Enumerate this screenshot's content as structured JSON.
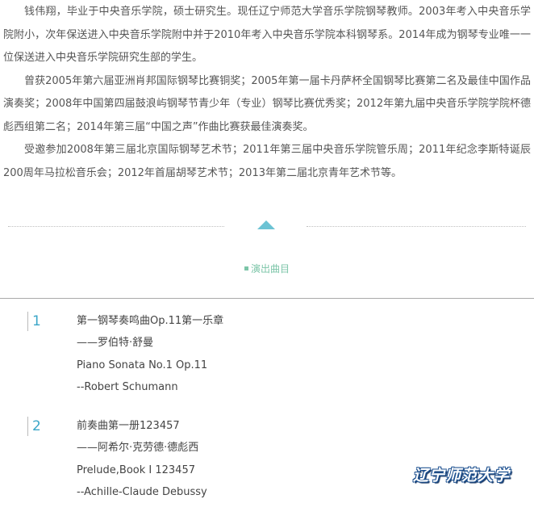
{
  "bio": {
    "paragraphs": [
      "钱伟翔，毕业于中央音乐学院，硕士研究生。现任辽宁师范大学音乐学院钢琴教师。2003年考入中央音乐学院附小，次年保送进入中央音乐学院附中并于2010年考入中央音乐学院本科钢琴系。2014年成为钢琴专业唯一一位保送进入中央音乐学院研究生部的学生。",
      "曾获2005年第六届亚洲肖邦国际钢琴比赛铜奖；2005年第一届卡丹萨杯全国钢琴比赛第二名及最佳中国作品演奏奖；2008年中国第四届鼓浪屿钢琴节青少年（专业）钢琴比赛优秀奖；2012年第九届中央音乐学院学院杯德彪西组第二名；2014年第三届“中国之声”作曲比赛获最佳演奏奖。",
      "受邀参加2008年第三届北京国际钢琴艺术节；2011年第三届中央音乐学院管乐周；2011年纪念李斯特诞辰200周年马拉松音乐会；2012年首届胡琴艺术节；2013年第二届北京青年艺术节等。"
    ]
  },
  "section": {
    "label": "演出曲目"
  },
  "program": [
    {
      "number": "1",
      "title_cn": "第一钢琴奏鸣曲Op.11第一乐章",
      "composer_cn": "——罗伯特·舒曼",
      "title_en": "Piano Sonata No.1 Op.11",
      "composer_en": "--Robert Schumann"
    },
    {
      "number": "2",
      "title_cn": "前奏曲第一册123457",
      "composer_cn": "——阿希尔·克劳德·德彪西",
      "title_en": "Prelude,Book I 123457",
      "composer_en": "--Achille-Claude Debussy"
    }
  ],
  "watermark": {
    "text": "辽宁师范大学"
  },
  "colors": {
    "accent": "#6cc3d4",
    "label_green": "#7cc5a8",
    "number_blue": "#3ba6c8",
    "text": "#555555"
  },
  "icons": {
    "divider": "triangle-up-icon",
    "section_marker": "square-bullet-icon"
  }
}
